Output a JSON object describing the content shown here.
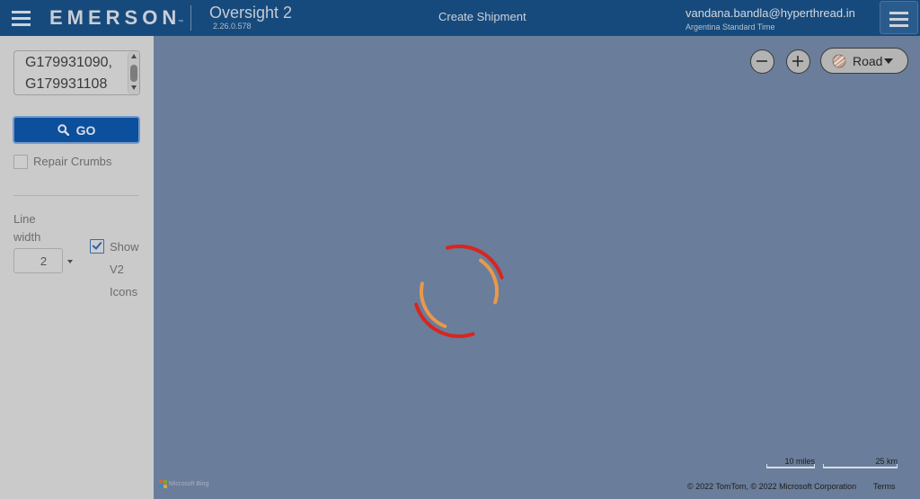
{
  "header": {
    "menu_icon": "hamburger-icon",
    "brand": "EMERSON",
    "brand_trademark": "™",
    "app_name": "Oversight 2",
    "app_version": "2.26.0.578",
    "nav_link": "Create Shipment",
    "user_email": "vandana.bandla@hyperthread.in",
    "user_timezone": "Argentina Standard Time",
    "right_menu_icon": "hamburger-icon"
  },
  "sidebar": {
    "shipment_ids": "G179931090,\nG179931108",
    "go_button": {
      "icon": "search-icon",
      "label": "GO"
    },
    "repair_crumbs": {
      "label": "Repair Crumbs",
      "checked": false
    },
    "line_width": {
      "label": "Line width",
      "value": "2",
      "icon": "caret-down-icon"
    },
    "show_v2_icons": {
      "label": "Show V2 Icons",
      "checked": true
    }
  },
  "map": {
    "loading": true,
    "zoom_out_icon": "minus-icon",
    "zoom_in_icon": "plus-icon",
    "style_selector": {
      "icon": "road-icon",
      "value": "Road"
    },
    "provider_logo": "Microsoft Bing",
    "scale": {
      "imperial": "10 miles",
      "metric": "25 km"
    },
    "copyright": "© 2022 TomTom, © 2022 Microsoft Corporation",
    "terms_link": "Terms"
  },
  "colors": {
    "header_bg": "#174a7c",
    "sidebar_bg": "#cacaca",
    "map_bg": "#6a7d9a",
    "go_button_bg": "#0c4f9c",
    "checkbox_check": "#2d5fa8",
    "spinner_outer": "#d8261e",
    "spinner_inner": "#e8994c"
  }
}
